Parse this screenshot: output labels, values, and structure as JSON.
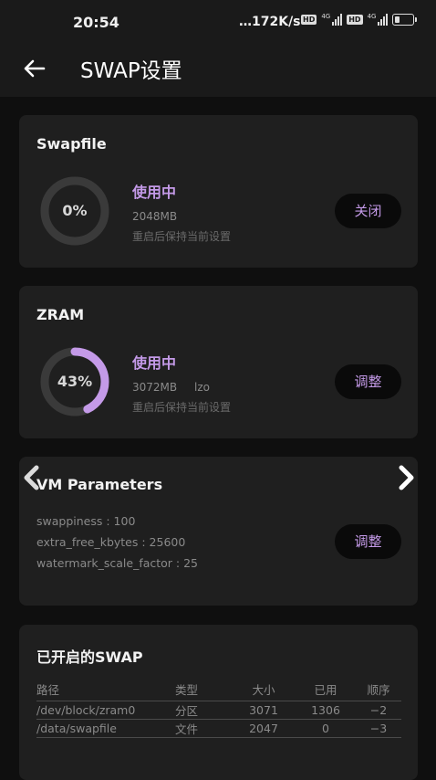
{
  "status_bar": {
    "time": "20:54",
    "network_speed": "…172K/s",
    "hd_badge_1": "HD",
    "hd_badge_2": "HD",
    "gen_1": "4G",
    "gen_2": "4G"
  },
  "app_bar": {
    "title": "SWAP设置"
  },
  "swapfile": {
    "title": "Swapfile",
    "percent_label": "0%",
    "percent": 0,
    "status": "使用中",
    "size": "2048MB",
    "note": "重启后保持当前设置",
    "button": "关闭"
  },
  "zram": {
    "title": "ZRAM",
    "percent_label": "43%",
    "percent": 43,
    "status": "使用中",
    "size": "3072MB",
    "algorithm": "lzo",
    "note": "重启后保持当前设置",
    "button": "调整"
  },
  "vm": {
    "title": "VM Parameters",
    "params": [
      "swappiness : 100",
      "extra_free_kbytes : 25600",
      "watermark_scale_factor : 25"
    ],
    "button": "调整"
  },
  "swaps": {
    "title": "已开启的SWAP",
    "headers": [
      "路径",
      "类型",
      "大小",
      "已用",
      "顺序"
    ],
    "rows": [
      [
        "/dev/block/zram0",
        "分区",
        "3071",
        "1306",
        "−2"
      ],
      [
        "/data/swapfile",
        "文件",
        "2047",
        "0",
        "−3"
      ]
    ]
  },
  "colors": {
    "accent": "#c49ae8",
    "card": "#1f1f1f",
    "background": "#0f0f0f",
    "ring_track": "#3a3a3a"
  },
  "icons": {
    "back": "arrow-left-icon",
    "prev": "chevron-left-icon",
    "next": "chevron-right-icon"
  }
}
